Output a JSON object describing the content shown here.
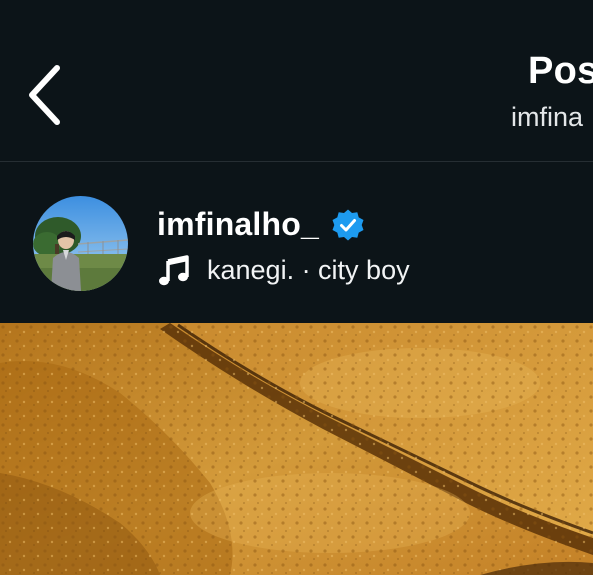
{
  "header": {
    "back_icon": "chevron-left-icon",
    "title": "Pos",
    "subtitle": "imfina"
  },
  "post": {
    "author": {
      "username": "imfinalho_",
      "verified": true,
      "verified_icon": "verified-badge-icon",
      "verified_color": "#1d9bf0",
      "avatar_icon": "profile-photo"
    },
    "music": {
      "icon": "music-note-icon",
      "artist": "kanegi.",
      "separator": "·",
      "track": "city boy",
      "text": "kanegi. · city boy"
    },
    "image": {
      "description_icon": "post-photo"
    }
  },
  "colors": {
    "background": "#0c1418",
    "divider": "#262e33",
    "text_primary": "#ffffff",
    "accent_verified": "#1d9bf0",
    "photo_rock": "#c98a28"
  }
}
